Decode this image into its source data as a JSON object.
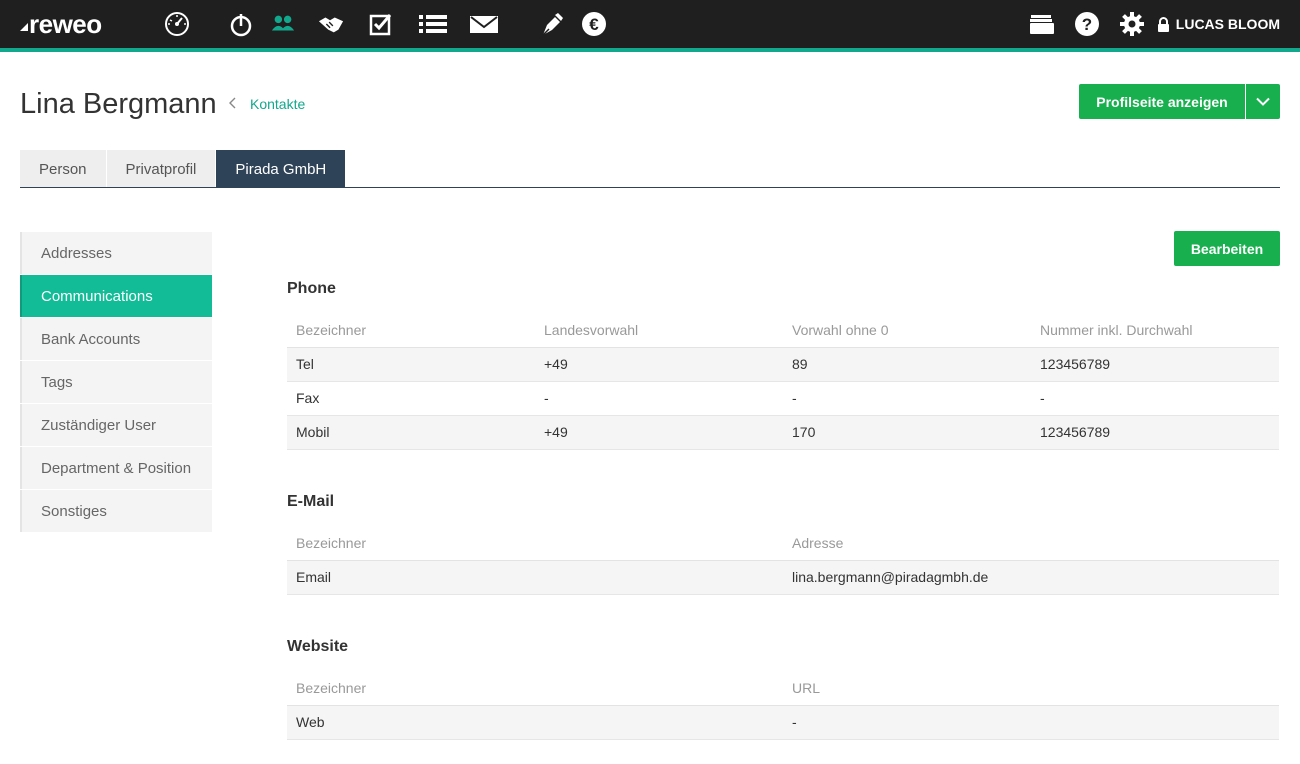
{
  "app": {
    "logo": "reweo",
    "user_name": "LUCAS BLOOM"
  },
  "nav_icons": [
    "dashboard-icon",
    "time-tracking-icon",
    "contacts-icon",
    "deals-icon",
    "tasks-icon",
    "list-icon",
    "mail-icon",
    "pen-icon",
    "euro-icon"
  ],
  "right_icons": [
    "folder-icon",
    "help-icon",
    "settings-icon",
    "lock-icon"
  ],
  "colors": {
    "accent": "#12a88d",
    "button_green": "#18b04f",
    "active_tab": "#2f4358",
    "sidebar_active": "#12bc96"
  },
  "header": {
    "title": "Lina Bergmann",
    "breadcrumb_link": "Kontakte",
    "profile_button": "Profilseite anzeigen"
  },
  "tabs": [
    {
      "label": "Person"
    },
    {
      "label": "Privatprofil"
    },
    {
      "label": "Pirada GmbH",
      "active": true
    }
  ],
  "sidebar": {
    "items": [
      {
        "label": "Addresses"
      },
      {
        "label": "Communications",
        "active": true
      },
      {
        "label": "Bank Accounts"
      },
      {
        "label": "Tags"
      },
      {
        "label": "Zuständiger User"
      },
      {
        "label": "Department & Position"
      },
      {
        "label": "Sonstiges"
      }
    ]
  },
  "main": {
    "edit_button": "Bearbeiten",
    "phone": {
      "title": "Phone",
      "headers": [
        "Bezeichner",
        "Landesvorwahl",
        "Vorwahl ohne 0",
        "Nummer inkl. Durchwahl"
      ],
      "rows": [
        [
          "Tel",
          "+49",
          "89",
          "123456789"
        ],
        [
          "Fax",
          "-",
          "-",
          "-"
        ],
        [
          "Mobil",
          "+49",
          "170",
          "123456789"
        ]
      ]
    },
    "email": {
      "title": "E-Mail",
      "headers": [
        "Bezeichner",
        "Adresse"
      ],
      "rows": [
        [
          "Email",
          "lina.bergmann@piradagmbh.de"
        ]
      ]
    },
    "website": {
      "title": "Website",
      "headers": [
        "Bezeichner",
        "URL"
      ],
      "rows": [
        [
          "Web",
          "-"
        ]
      ]
    }
  }
}
